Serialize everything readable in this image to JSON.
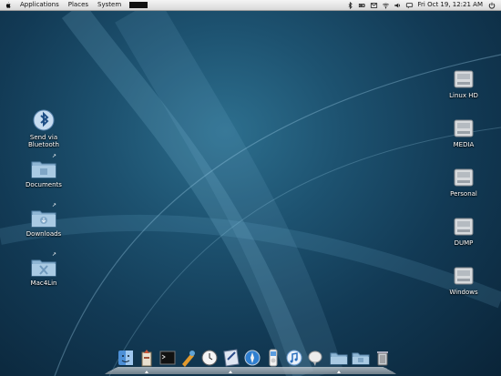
{
  "menubar": {
    "menus": [
      "Applications",
      "Places",
      "System"
    ],
    "clock": "Fri Oct 19, 12:21 AM",
    "tray_icons": [
      "bluetooth-icon",
      "battery-icon",
      "mail-icon",
      "wifi-icon",
      "volume-icon",
      "chat-icon"
    ]
  },
  "desktop": {
    "left_icons": [
      {
        "label": "Send via Bluetooth",
        "icon": "bluetooth-send-icon"
      },
      {
        "label": "Documents",
        "icon": "documents-folder-icon"
      },
      {
        "label": "Downloads",
        "icon": "downloads-folder-icon"
      },
      {
        "label": "Mac4Lin",
        "icon": "mac4lin-folder-icon"
      }
    ],
    "right_icons": [
      {
        "label": "Linux HD",
        "icon": "hard-drive-icon"
      },
      {
        "label": "MEDIA",
        "icon": "hard-drive-icon"
      },
      {
        "label": "Personal",
        "icon": "hard-drive-icon"
      },
      {
        "label": "DUMP",
        "icon": "hard-drive-icon"
      },
      {
        "label": "Windows",
        "icon": "hard-drive-icon"
      }
    ]
  },
  "dock": {
    "items": [
      "finder-icon",
      "system-monitor-icon",
      "terminal-icon",
      "gimp-icon",
      "clock-icon",
      "text-editor-icon",
      "safari-icon",
      "ipod-icon",
      "itunes-icon",
      "pidgin-icon",
      "folder-icon",
      "documents-stack-icon",
      "trash-icon"
    ]
  }
}
